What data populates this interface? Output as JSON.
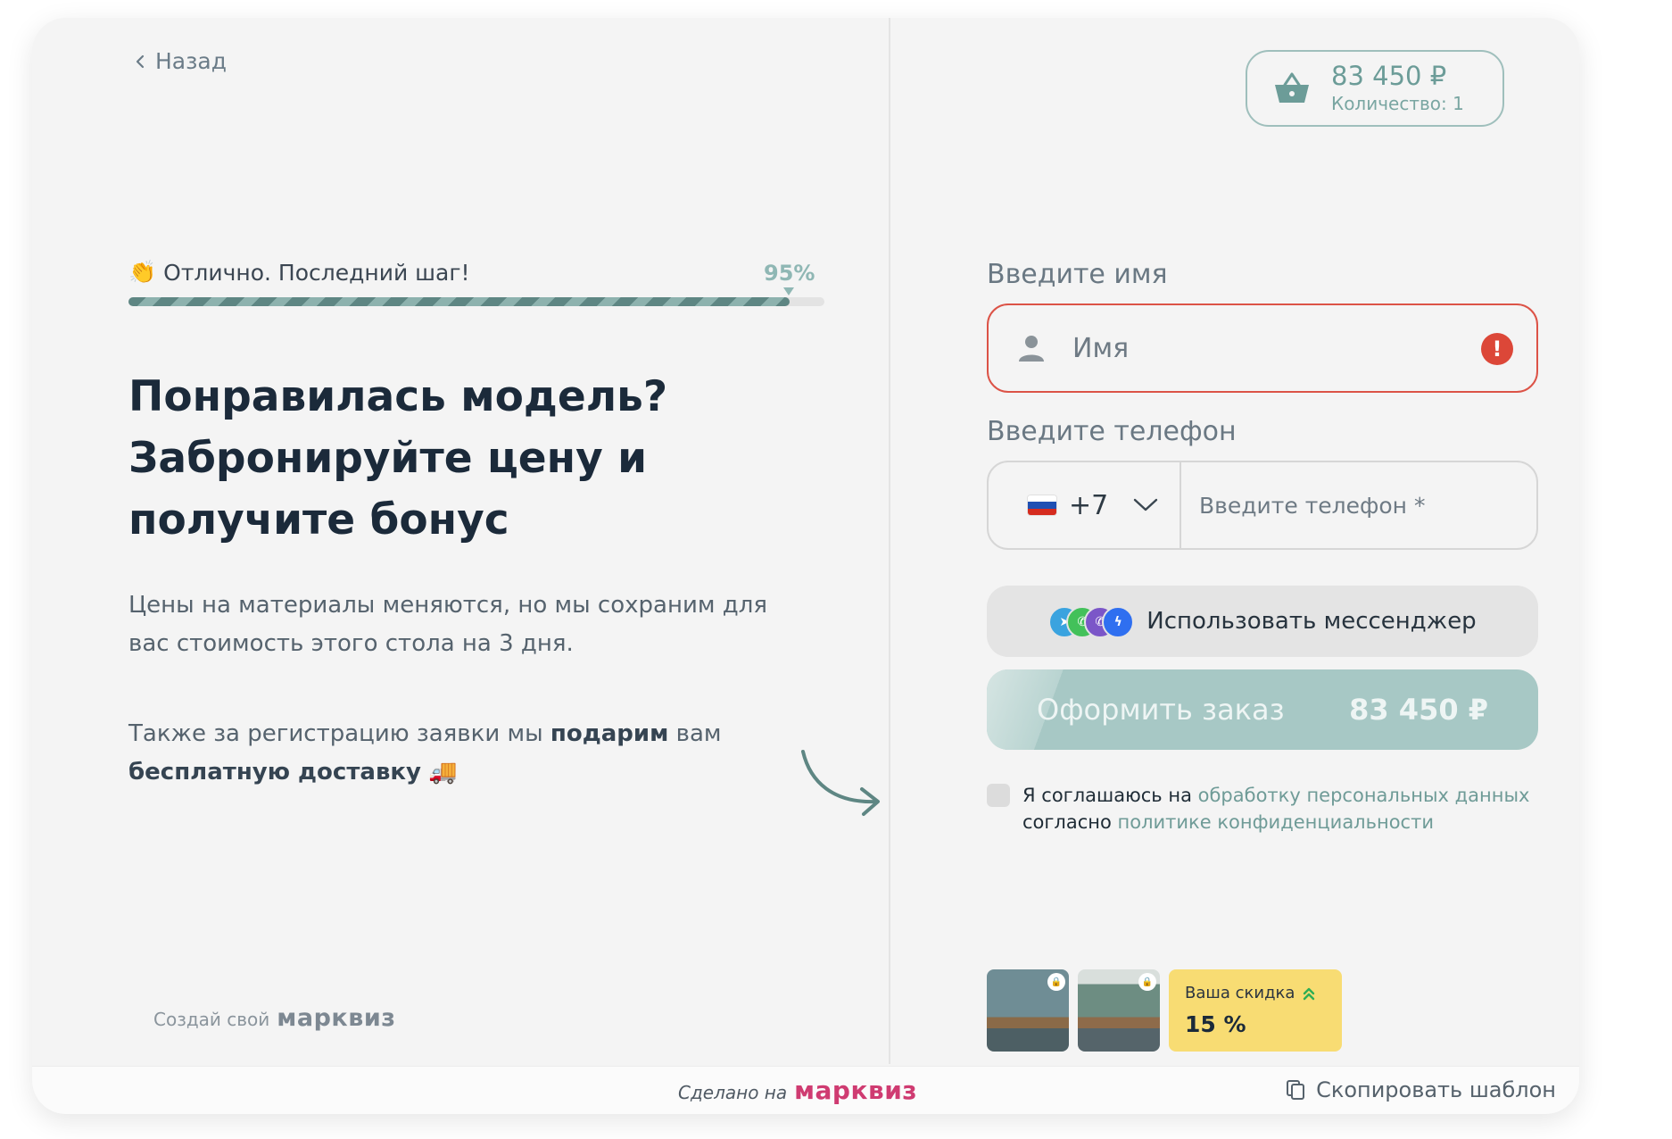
{
  "nav": {
    "back_label": "Назад"
  },
  "cart": {
    "price": "83 450 ₽",
    "quantity": "Количество: 1"
  },
  "progress": {
    "emoji": "👏",
    "label": "Отлично. Последний шаг!",
    "percent_label": "95%",
    "value": 0.95
  },
  "content": {
    "headline": "Понравилась модель? Забронируйте цену и получите бонус",
    "paragraph1": "Цены на материалы меняются, но мы сохраним для вас стоимость этого стола на 3 дня.",
    "paragraph2": {
      "part1": "Также за регистрацию заявки мы ",
      "bold1": "подарим",
      "part2": " вам ",
      "bold2": "бесплатную доставку",
      "emoji": "🚚"
    }
  },
  "form": {
    "name_label": "Введите имя",
    "name_placeholder": "Имя",
    "phone_label": "Введите телефон",
    "country_code": "+7",
    "phone_placeholder": "Введите телефон *",
    "messenger_label": "Использовать мессенджер",
    "order_label": "Оформить заказ",
    "order_price": "83 450 ₽",
    "consent": {
      "text1": "Я соглашаюсь на ",
      "link1": "обработку персональных данных",
      "text2": " согласно ",
      "link2": "политике конфиденциальности"
    }
  },
  "discount": {
    "label": "Ваша скидка",
    "value": "15 %"
  },
  "branding": {
    "left_prefix": "Создай свой",
    "left_logo": "марквиз",
    "footer_prefix": "Сделано на",
    "footer_logo": "марквиз",
    "copy_label": "Скопировать шаблон"
  },
  "colors": {
    "accent": "#8fb7b4",
    "error": "#dc4738",
    "discount_bg": "#f8dc73",
    "brand": "#cf3b71"
  },
  "icons": [
    "chevron-left-icon",
    "clap-emoji",
    "basket-icon",
    "person-icon",
    "error-icon",
    "chevron-down-icon",
    "telegram-icon",
    "whatsapp-icon",
    "viber-icon",
    "messenger-icon",
    "lock-icon",
    "double-chevron-up-icon",
    "copy-icon",
    "curved-arrow-icon"
  ]
}
